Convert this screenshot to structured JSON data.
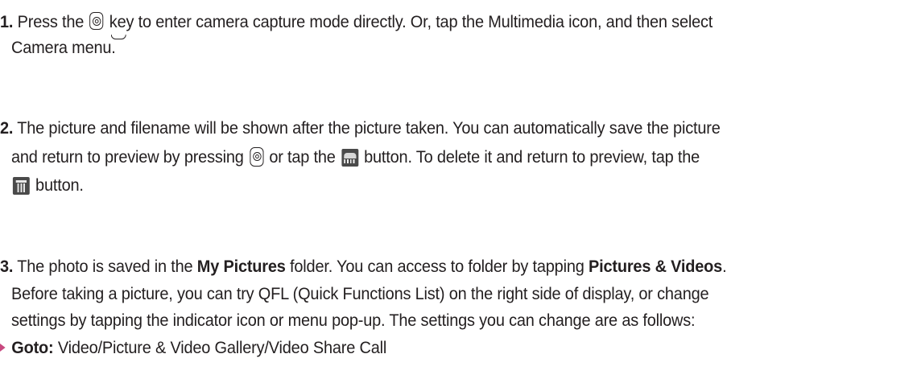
{
  "items": [
    {
      "number": "1.",
      "l1_a": " Press the ",
      "l1_b": " key to enter camera capture mode directly. Or, tap the Multimedia icon, and then select",
      "l2": "Camera menu."
    },
    {
      "number": "2.",
      "l1": " The picture and filename will be shown after the picture taken. You can automatically save the picture",
      "l2_a": "and return to preview by pressing ",
      "l2_b": " or tap the ",
      "l2_c": " button. To delete it and return to preview, tap the",
      "l3": " button."
    },
    {
      "number": "3.",
      "l1_a": " The photo is saved in the ",
      "l1_bold1": "My Pictures",
      "l1_b": " folder. You can access to folder by tapping ",
      "l1_bold2": "Pictures & Videos",
      "l1_c": ".",
      "l2": "Before taking a picture, you can try QFL (Quick Functions List) on the right side of display, or change",
      "l3": "settings by tapping the indicator icon or menu pop-up. The settings you can change are as follows:"
    }
  ],
  "bullet_item": {
    "label": "Goto:",
    "text": " Video/Picture & Video Gallery/Video Share Call"
  },
  "icons": [
    "camera-key-icon",
    "save-new-icon",
    "trash-icon",
    "bullet-arrow-icon"
  ],
  "colors": {
    "text": "#231f20",
    "bullet": "#c8487f",
    "icon_bg": "#4a4a4a"
  }
}
